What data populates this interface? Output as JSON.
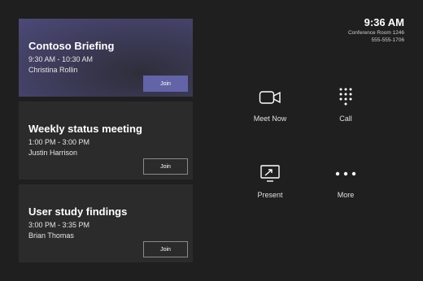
{
  "clock": {
    "time": "9:36 AM",
    "room": "Conference Room 1246",
    "phone": "555-555-1706"
  },
  "meetings": [
    {
      "title": "Contoso Briefing",
      "time": "9:30 AM - 10:30 AM",
      "host": "Christina Rollin",
      "join_label": "Join"
    },
    {
      "title": "Weekly status meeting",
      "time": "1:00 PM - 3:00 PM",
      "host": "Justin Harrison",
      "join_label": "Join"
    },
    {
      "title": "User study findings",
      "time": "3:00 PM - 3:35 PM",
      "host": "Brian Thomas",
      "join_label": "Join"
    }
  ],
  "actions": {
    "meet_now": "Meet Now",
    "call": "Call",
    "present": "Present",
    "more": "More"
  },
  "colors": {
    "background": "#1f1f1f",
    "card": "#2b2b2b",
    "accent": "#6264a7"
  },
  "icons": [
    "video-camera-icon",
    "dialpad-icon",
    "present-screen-icon",
    "more-dots-icon"
  ]
}
